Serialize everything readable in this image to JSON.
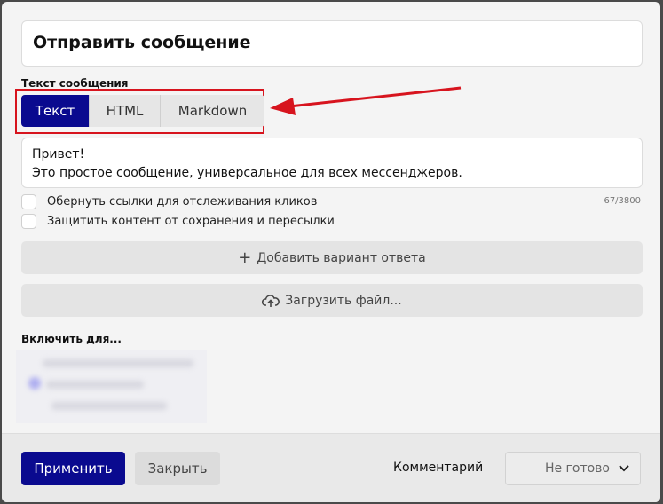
{
  "title": "Отправить сообщение",
  "message_label": "Текст сообщения",
  "tabs": [
    {
      "label": "Текст",
      "active": true
    },
    {
      "label": "HTML",
      "active": false
    },
    {
      "label": "Markdown",
      "active": false
    }
  ],
  "message": {
    "line1": "Привет!",
    "line2": "Это простое сообщение, универсальное для всех мессенджеров."
  },
  "options": {
    "wrap_links": "Обернуть ссылки для отслеживания кликов",
    "protect_content": "Защитить контент от сохранения и пересылки",
    "counter": "67/3800"
  },
  "add_answer": {
    "icon": "plus-icon",
    "label": "Добавить вариант ответа"
  },
  "upload": {
    "icon": "cloud-upload-icon",
    "label": "Загрузить файл..."
  },
  "include_for_label": "Включить для...",
  "footer": {
    "apply": "Применить",
    "close": "Закрыть",
    "comment": "Комментарий",
    "status": "Не готово"
  },
  "colors": {
    "accent": "#0a0a8f",
    "highlight": "#d7141e"
  }
}
